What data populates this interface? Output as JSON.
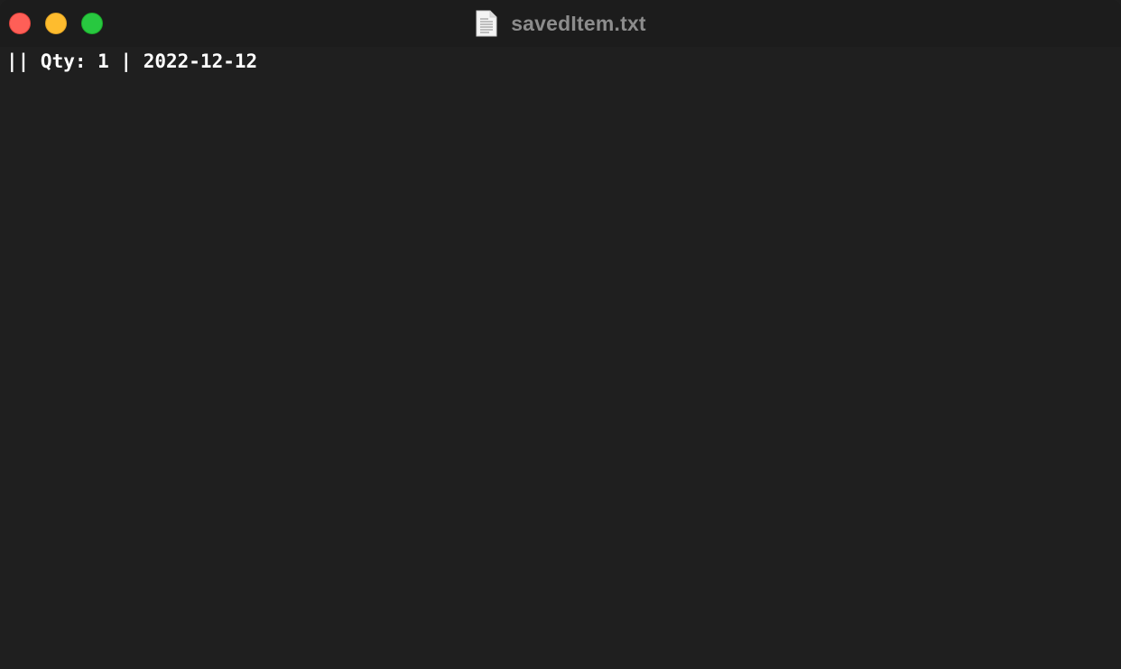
{
  "window": {
    "title": "savedItem.txt",
    "title_icon": "text-document-icon"
  },
  "traffic_lights": {
    "close_color": "#fe5f57",
    "minimize_color": "#febc2e",
    "zoom_color": "#28c840"
  },
  "editor": {
    "lines": [
      "|| Qty: 1 | 2022-12-12"
    ]
  },
  "colors": {
    "background": "#1f1f1f",
    "text": "#ffffff",
    "title_text": "#8c8c8c"
  }
}
